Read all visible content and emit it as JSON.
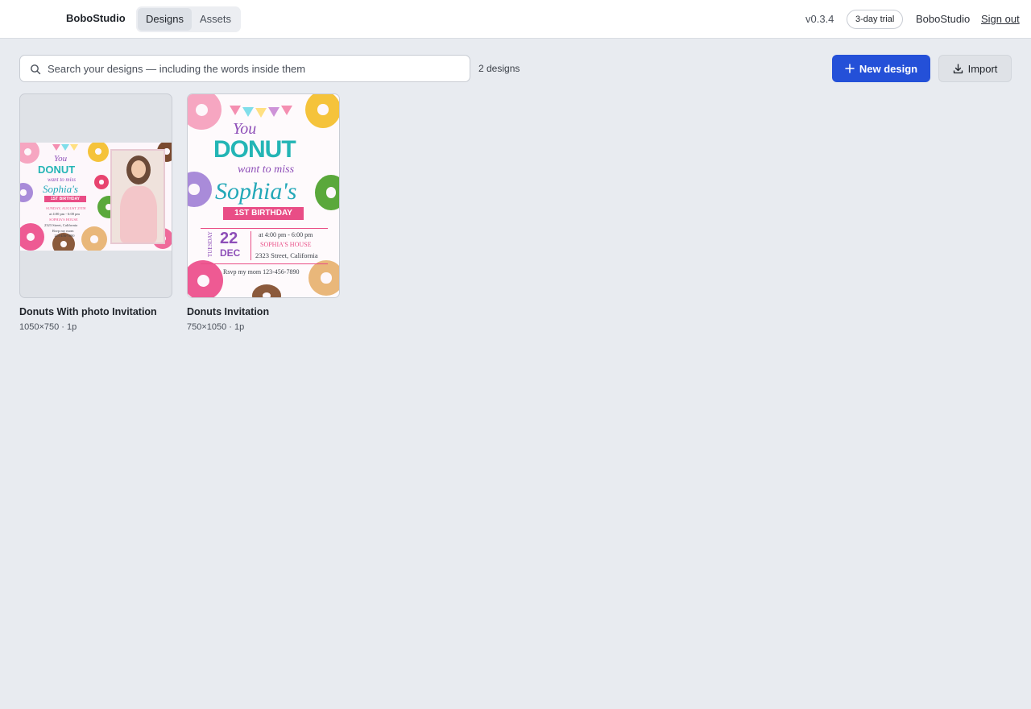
{
  "app": {
    "brand": "BoboStudio",
    "version": "v0.3.4",
    "trial_badge": "3-day trial",
    "account_name": "BoboStudio",
    "sign_out": "Sign out"
  },
  "tabs": [
    {
      "label": "Designs",
      "active": true
    },
    {
      "label": "Assets",
      "active": false
    }
  ],
  "toolbar": {
    "search_placeholder": "Search your designs — including the words inside them",
    "search_value": "",
    "design_count": "2 designs",
    "new_design_label": "New design",
    "import_label": "Import"
  },
  "designs": [
    {
      "title": "Donuts With photo Invitation",
      "meta": "1050×750 · 1p",
      "art": {
        "you": "You",
        "donut": "DONUT",
        "want": "want to miss",
        "name": "Sophia's",
        "ribbon": "1ST BIRTHDAY",
        "date": "SUNDAY, AUGUST 25TH",
        "time": "at 4:00 pm - 6:00 pm",
        "place": "SOPHIA'S HOUSE",
        "street": "2323 Street, California",
        "rsvp": "Rsvp my mom",
        "phone": "123-456-7890"
      }
    },
    {
      "title": "Donuts Invitation",
      "meta": "750×1050 · 1p",
      "art": {
        "you": "You",
        "donut": "DONUT",
        "want": "want to miss",
        "name": "Sophia's",
        "ribbon": "1ST BIRTHDAY",
        "weekday": "TUESDAY",
        "day": "22",
        "month": "DEC",
        "time": "at 4:00 pm - 6:00 pm",
        "place": "SOPHIA'S HOUSE",
        "street": "2323 Street, California",
        "rsvp": "Rsvp my mom 123-456-7890"
      }
    }
  ],
  "colors": {
    "accent": "#2450d8",
    "background": "#e8ebf0",
    "ribbon": "#e94d86",
    "donut_text_teal": "#23b5b5",
    "donut_text_purple": "#8e4fb8"
  }
}
